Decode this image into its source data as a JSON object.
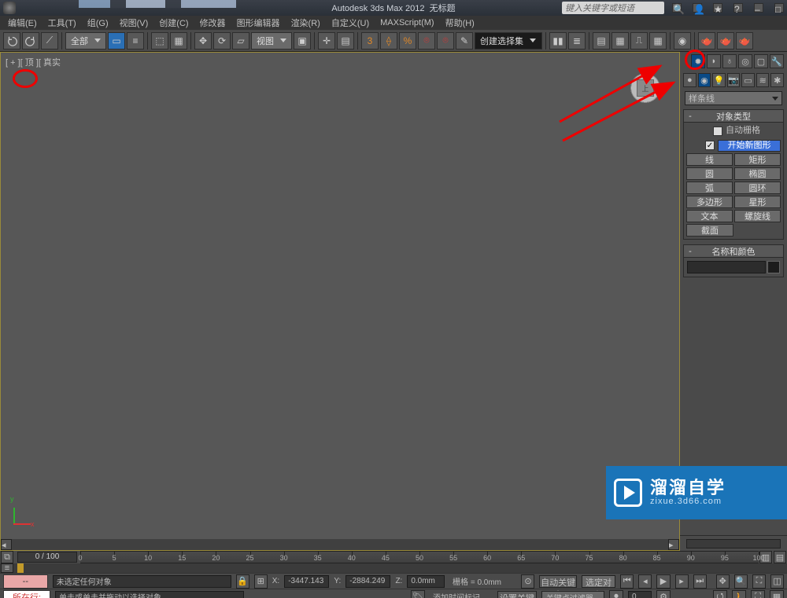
{
  "title": {
    "app": "Autodesk 3ds Max 2012",
    "doc": "无标题"
  },
  "search": {
    "placeholder": "键入关键字或短语"
  },
  "menus": [
    "编辑(E)",
    "工具(T)",
    "组(G)",
    "视图(V)",
    "创建(C)",
    "修改器",
    "图形编辑器",
    "渲染(R)",
    "自定义(U)",
    "MAXScript(M)",
    "帮助(H)"
  ],
  "toolbar": {
    "all": "全部",
    "view": "视图",
    "createSel": "创建选择集"
  },
  "viewport": {
    "label": "[ + ][ 顶 ][ 真实",
    "cubeFace": "上"
  },
  "cmdPanel": {
    "splineDD": "样条线",
    "rollout1": "对象类型",
    "autoGrid": "自动栅格",
    "startShape": "开始新图形",
    "buttons": [
      [
        "线",
        "矩形"
      ],
      [
        "圆",
        "椭圆"
      ],
      [
        "弧",
        "圆环"
      ],
      [
        "多边形",
        "星形"
      ],
      [
        "文本",
        "螺旋线"
      ]
    ],
    "sectionBtn": "截面",
    "rollout2": "名称和颜色"
  },
  "timeline": {
    "frames": "0 / 100",
    "ticks": [
      0,
      5,
      10,
      15,
      20,
      25,
      30,
      35,
      40,
      45,
      50,
      55,
      60,
      65,
      70,
      75,
      80,
      85,
      90,
      95,
      100
    ]
  },
  "status": {
    "row1": {
      "pink": "--",
      "msg": "未选定任何对象",
      "x": "-3447.143",
      "y": "-2884.249",
      "z": "0.0mm",
      "grid": "栅格 = 0.0mm",
      "autoKey": "自动关键点",
      "selObj": "选定对象"
    },
    "row2": {
      "pink": "所在行:",
      "msg": "单击或单击并拖动以选择对象",
      "addTag": "添加时间标记",
      "setKey": "设置关键点",
      "keyFilter": "关键点过滤器...",
      "zero": "0"
    }
  },
  "watermark": {
    "big": "溜溜自学",
    "small": "zixue.3d66.com"
  },
  "axis": {
    "x": "x",
    "y": "y"
  },
  "coordPrefix": {
    "x": "X:",
    "y": "Y:",
    "z": "Z:"
  }
}
